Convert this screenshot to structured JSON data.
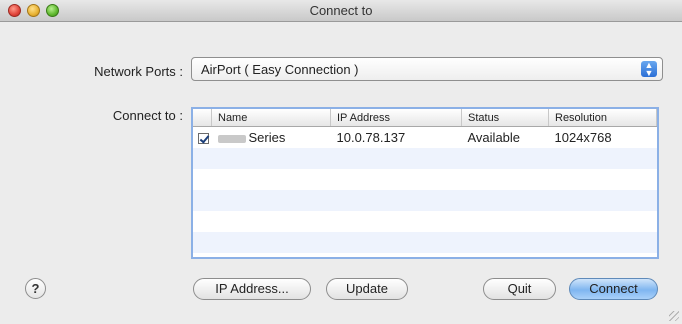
{
  "window": {
    "title": "Connect to"
  },
  "network_ports": {
    "label": "Network Ports :",
    "selected": "AirPort ( Easy Connection )"
  },
  "connect_to": {
    "label": "Connect to :",
    "columns": [
      "Name",
      "IP Address",
      "Status",
      "Resolution"
    ],
    "rows": [
      {
        "checked": true,
        "name": "Series",
        "ip": "10.0.78.137",
        "status": "Available",
        "resolution": "1024x768"
      }
    ]
  },
  "buttons": {
    "help": "?",
    "ip_address": "IP Address...",
    "update": "Update",
    "quit": "Quit",
    "connect": "Connect"
  },
  "icons": {
    "close": "close-icon",
    "minimize": "minimize-icon",
    "zoom": "zoom-icon",
    "popup": "chevron-updown-icon",
    "resize": "resize-grip-icon"
  }
}
